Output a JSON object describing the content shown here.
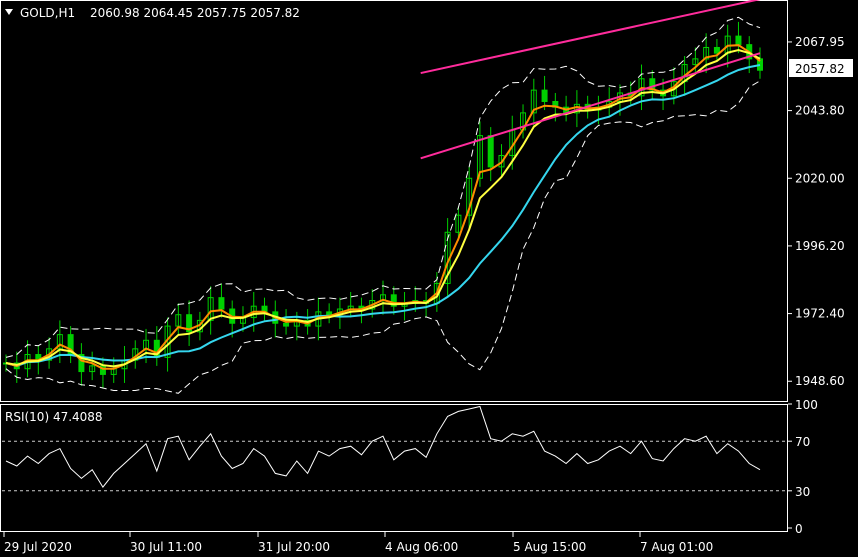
{
  "header": {
    "symbol": "GOLD,H1",
    "ohlc": "2060.98 2064.45 2057.75 2057.82"
  },
  "rsi": {
    "label": "RSI(10) 47.4088"
  },
  "colors": {
    "background": "#000000",
    "frame": "#ffffff",
    "candles": "#00d000",
    "ema_fast": "#ff8c00",
    "ema_slow": "#ffff40",
    "sma_long": "#35d6ee",
    "bollinger": "#ffffff",
    "channel": "#ff2c9c",
    "price_tag_bg": "#ffffff",
    "price_tag_text": "#000000"
  },
  "chart_data": [
    {
      "type": "candlestick",
      "symbol": "GOLD",
      "timeframe": "H1",
      "current_price": "2057.82",
      "y_ticks": [
        "2067.95",
        "2043.80",
        "2020.00",
        "1996.20",
        "1972.40",
        "1948.60"
      ],
      "ylim": [
        1942,
        2082
      ],
      "x_ticks": [
        "29 Jul 2020",
        "30 Jul 11:00",
        "31 Jul 20:00",
        "4 Aug 06:00",
        "5 Aug 15:00",
        "7 Aug 01:00"
      ],
      "trend_channel": {
        "upper": [
          [
            55,
            2057
          ],
          [
            100,
            2083
          ]
        ],
        "lower": [
          [
            55,
            2027
          ],
          [
            100,
            2064
          ]
        ]
      },
      "series": [
        {
          "name": "close",
          "values": [
            1955,
            1953,
            1958,
            1956,
            1960,
            1965,
            1958,
            1952,
            1954,
            1951,
            1953,
            1956,
            1960,
            1963,
            1957,
            1968,
            1972,
            1966,
            1970,
            1978,
            1974,
            1969,
            1971,
            1975,
            1973,
            1969,
            1968,
            1970,
            1968,
            1973,
            1972,
            1974,
            1975,
            1974,
            1977,
            1979,
            1975,
            1976,
            1977,
            1976,
            1983,
            2001,
            2007,
            2020,
            2035,
            2024,
            2028,
            2037,
            2043,
            2051,
            2047,
            2045,
            2043,
            2046,
            2044,
            2045,
            2047,
            2050,
            2049,
            2055,
            2051,
            2049,
            2054,
            2060,
            2062,
            2066,
            2064,
            2070,
            2067,
            2062,
            2058
          ]
        }
      ]
    },
    {
      "type": "line",
      "name": "RSI(10)",
      "current": "47.4088",
      "y_ticks": [
        "100",
        "70",
        "30",
        "0"
      ],
      "levels": [
        70,
        30
      ],
      "ylim": [
        0,
        100
      ],
      "values": [
        54,
        50,
        58,
        52,
        60,
        64,
        48,
        40,
        47,
        33,
        44,
        52,
        60,
        68,
        46,
        72,
        74,
        55,
        66,
        76,
        58,
        48,
        52,
        64,
        58,
        44,
        42,
        54,
        44,
        62,
        58,
        64,
        66,
        59,
        70,
        74,
        55,
        62,
        64,
        57,
        76,
        90,
        94,
        96,
        98,
        72,
        70,
        76,
        74,
        78,
        62,
        58,
        52,
        60,
        52,
        55,
        62,
        66,
        60,
        70,
        56,
        54,
        64,
        72,
        70,
        74,
        60,
        68,
        62,
        52,
        47
      ]
    }
  ]
}
